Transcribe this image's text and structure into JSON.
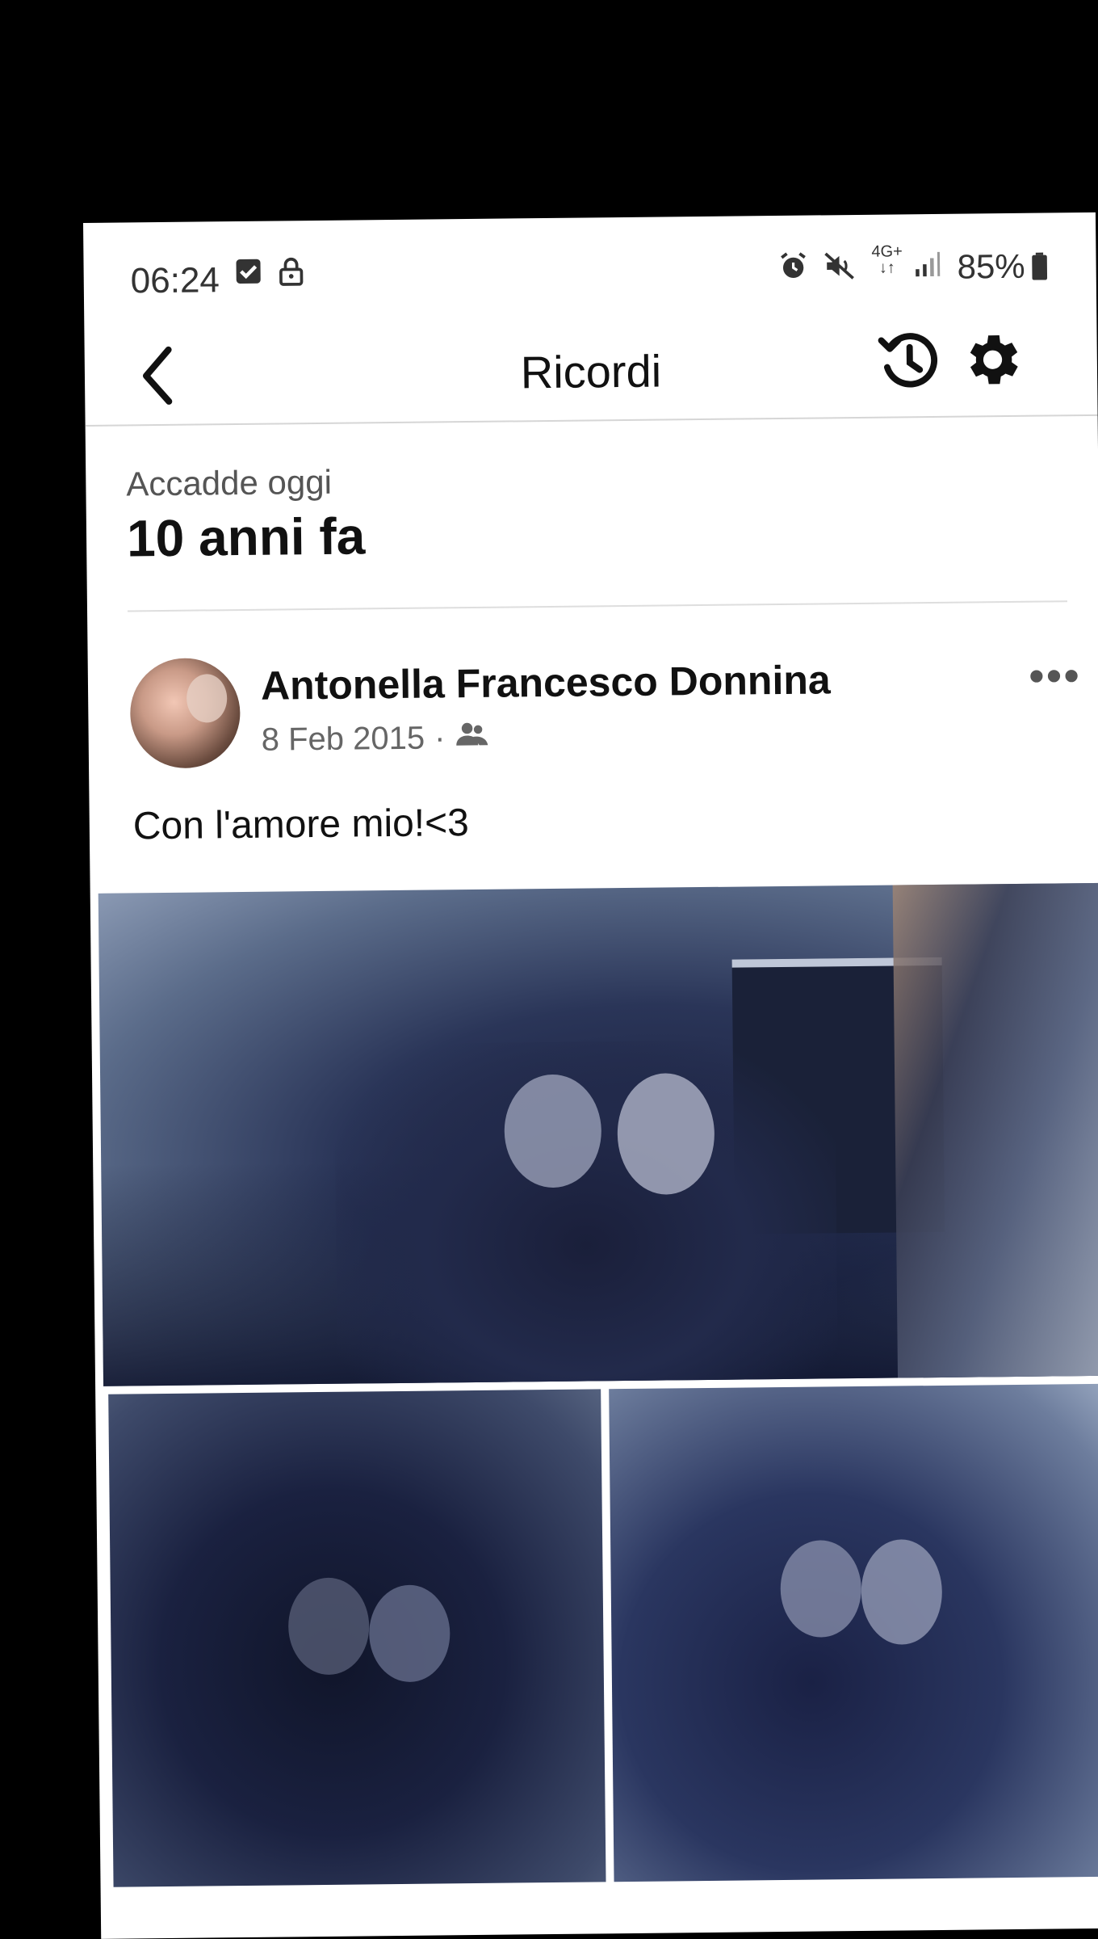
{
  "status_bar": {
    "time": "06:24",
    "network": "4G+",
    "battery": "85%",
    "icons": [
      "checkbox-icon",
      "lock-icon",
      "alarm-icon",
      "mute-icon",
      "signal-icon",
      "battery-icon"
    ]
  },
  "app_bar": {
    "title": "Ricordi",
    "icons": [
      "back-icon",
      "history-icon",
      "settings-gear-icon"
    ]
  },
  "memories": {
    "subtitle": "Accadde oggi",
    "heading": "10 anni fa"
  },
  "post": {
    "author": "Antonella Francesco Donnina",
    "date": "8 Feb 2015",
    "separator": "·",
    "audience_icon": "friends-icon",
    "more_icon": "more-icon",
    "caption": "Con l'amore mio!<3",
    "photos": [
      "post-photo-1",
      "post-photo-2",
      "post-photo-3"
    ]
  }
}
